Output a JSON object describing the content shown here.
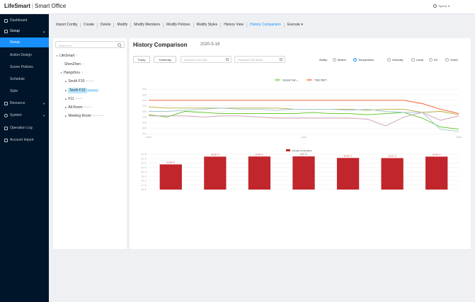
{
  "app": {
    "brand": "LifeSmart",
    "product": "Smart Office",
    "user_name": "Spend"
  },
  "sidebar": {
    "items": [
      {
        "label": "Dashboard",
        "icon": "dashboard-icon"
      },
      {
        "label": "Group",
        "icon": "group-icon",
        "open": true
      },
      {
        "label": "Group",
        "sub": true,
        "active": true
      },
      {
        "label": "Action Design",
        "sub": true
      },
      {
        "label": "Scene Policies",
        "sub": true
      },
      {
        "label": "Schedule",
        "sub": true
      },
      {
        "label": "Style",
        "sub": true
      },
      {
        "label": "Resource",
        "icon": "resource-icon"
      },
      {
        "label": "System",
        "icon": "system-icon"
      },
      {
        "label": "Operation Log",
        "icon": "log-icon"
      },
      {
        "label": "Account Import",
        "icon": "import-icon"
      }
    ]
  },
  "toolbar": {
    "tabs": [
      "Import Config",
      "Create",
      "Delete",
      "Modify",
      "Modify Members",
      "Modify Policies",
      "Modify Styles",
      "History View",
      "History Comparison",
      "Execute"
    ],
    "active_tab": "History Comparison",
    "execute_suffix": "▾"
  },
  "tree": {
    "search_placeholder": "Search for...",
    "nodes": [
      {
        "label": "LifeSmart",
        "tag": "(8)"
      },
      {
        "label": "ShenZhen",
        "tag": "(2)"
      },
      {
        "label": "Hangzhou",
        "tag": "(6)"
      },
      {
        "label": "South F10",
        "tag": "(Room F10 3)"
      },
      {
        "label": "North F10",
        "tag": "(Room F10 2)",
        "selected": true
      },
      {
        "label": "F11",
        "tag": "(Room F11)"
      },
      {
        "label": "All Room",
        "tag": "(Room all 3)"
      },
      {
        "label": "Meeting Room",
        "tag": "(Meeting Room 1)"
      }
    ]
  },
  "main": {
    "title": "History Comparison",
    "date": "2020-5-18",
    "today_label": "Today",
    "yesterday_label": "Yesterday",
    "one_day_placeholder": "Selected One Day",
    "one_week_placeholder": "Selected One Week",
    "ability_label": "Ability:",
    "abilities": [
      "Motion",
      "Temperature",
      "Humidity",
      "Lamp",
      "AC",
      "Outlet"
    ],
    "selected_ability": "Temperature"
  },
  "chart_data": [
    {
      "type": "line",
      "title": "",
      "series": [
        {
          "name": "Grand Can...",
          "color": "#52c41a",
          "values": [
            22.7,
            22.5,
            23.0,
            22.9,
            22.8,
            22.8,
            22.8,
            22.8,
            22.8,
            22.9,
            22.8,
            22.8,
            22.7,
            22.8,
            22.9,
            22.4,
            21.6,
            21.4
          ]
        },
        {
          "name": "THE MET",
          "color": "#fa541c",
          "values": [
            24.0,
            24.0,
            24.0,
            24.0,
            24.0,
            24.0,
            24.0,
            24.0,
            24.0,
            24.0,
            24.0,
            24.0,
            24.0,
            24.0,
            24.0,
            23.7,
            23.2,
            22.8
          ]
        },
        {
          "name": "",
          "color": "#c79fb0",
          "values": [
            22.6,
            22.6,
            22.6,
            22.5,
            22.6,
            22.6,
            22.5,
            22.4,
            22.4,
            22.4,
            22.4,
            22.4,
            22.3,
            21.7,
            22.5,
            22.9,
            22.2,
            22.6
          ]
        },
        {
          "name": "",
          "color": "#b5ab3a",
          "values": [
            23.4,
            23.3,
            23.3,
            23.3,
            23.3,
            23.3,
            23.3,
            23.3,
            23.2,
            23.2,
            23.2,
            23.2,
            23.1,
            23.2,
            23.2,
            22.9,
            23.0,
            22.7
          ]
        },
        {
          "name": "",
          "color": "#9fc7d4",
          "values": [
            23.0,
            23.0,
            23.1,
            23.2,
            23.3,
            23.2,
            23.2,
            23.1,
            23.2,
            23.2,
            23.2,
            23.1,
            23.2,
            23.0,
            22.9,
            22.9,
            21.4,
            21.2
          ]
        }
      ],
      "yticks": [
        "25.0",
        "24.5",
        "24.0",
        "23.5",
        "23.0",
        "22.5",
        "22.0",
        "21.5",
        "21.0"
      ],
      "ylim": [
        21,
        25
      ],
      "xticks": [
        "00:00",
        "12:00",
        "23:59"
      ]
    },
    {
      "type": "bar",
      "legend": "Average Temperature",
      "color": "#c0262b",
      "values": [
        21.69,
        23.45,
        23.48,
        23.5,
        23.15,
        23.12,
        23.45
      ],
      "data_labels": [
        "21.69 °C",
        "23.45 °C",
        "23.48 °C",
        "23.5 °C",
        "23.15 °C",
        "23.12 °C",
        "23.45 °C"
      ],
      "yticks": [
        "24 °C",
        "23 °C",
        "22 °C",
        "21 °C",
        "20 °C",
        "19 °C",
        "18 °C",
        "17 °C",
        "16 °C"
      ],
      "ylim": [
        16,
        24
      ]
    }
  ]
}
